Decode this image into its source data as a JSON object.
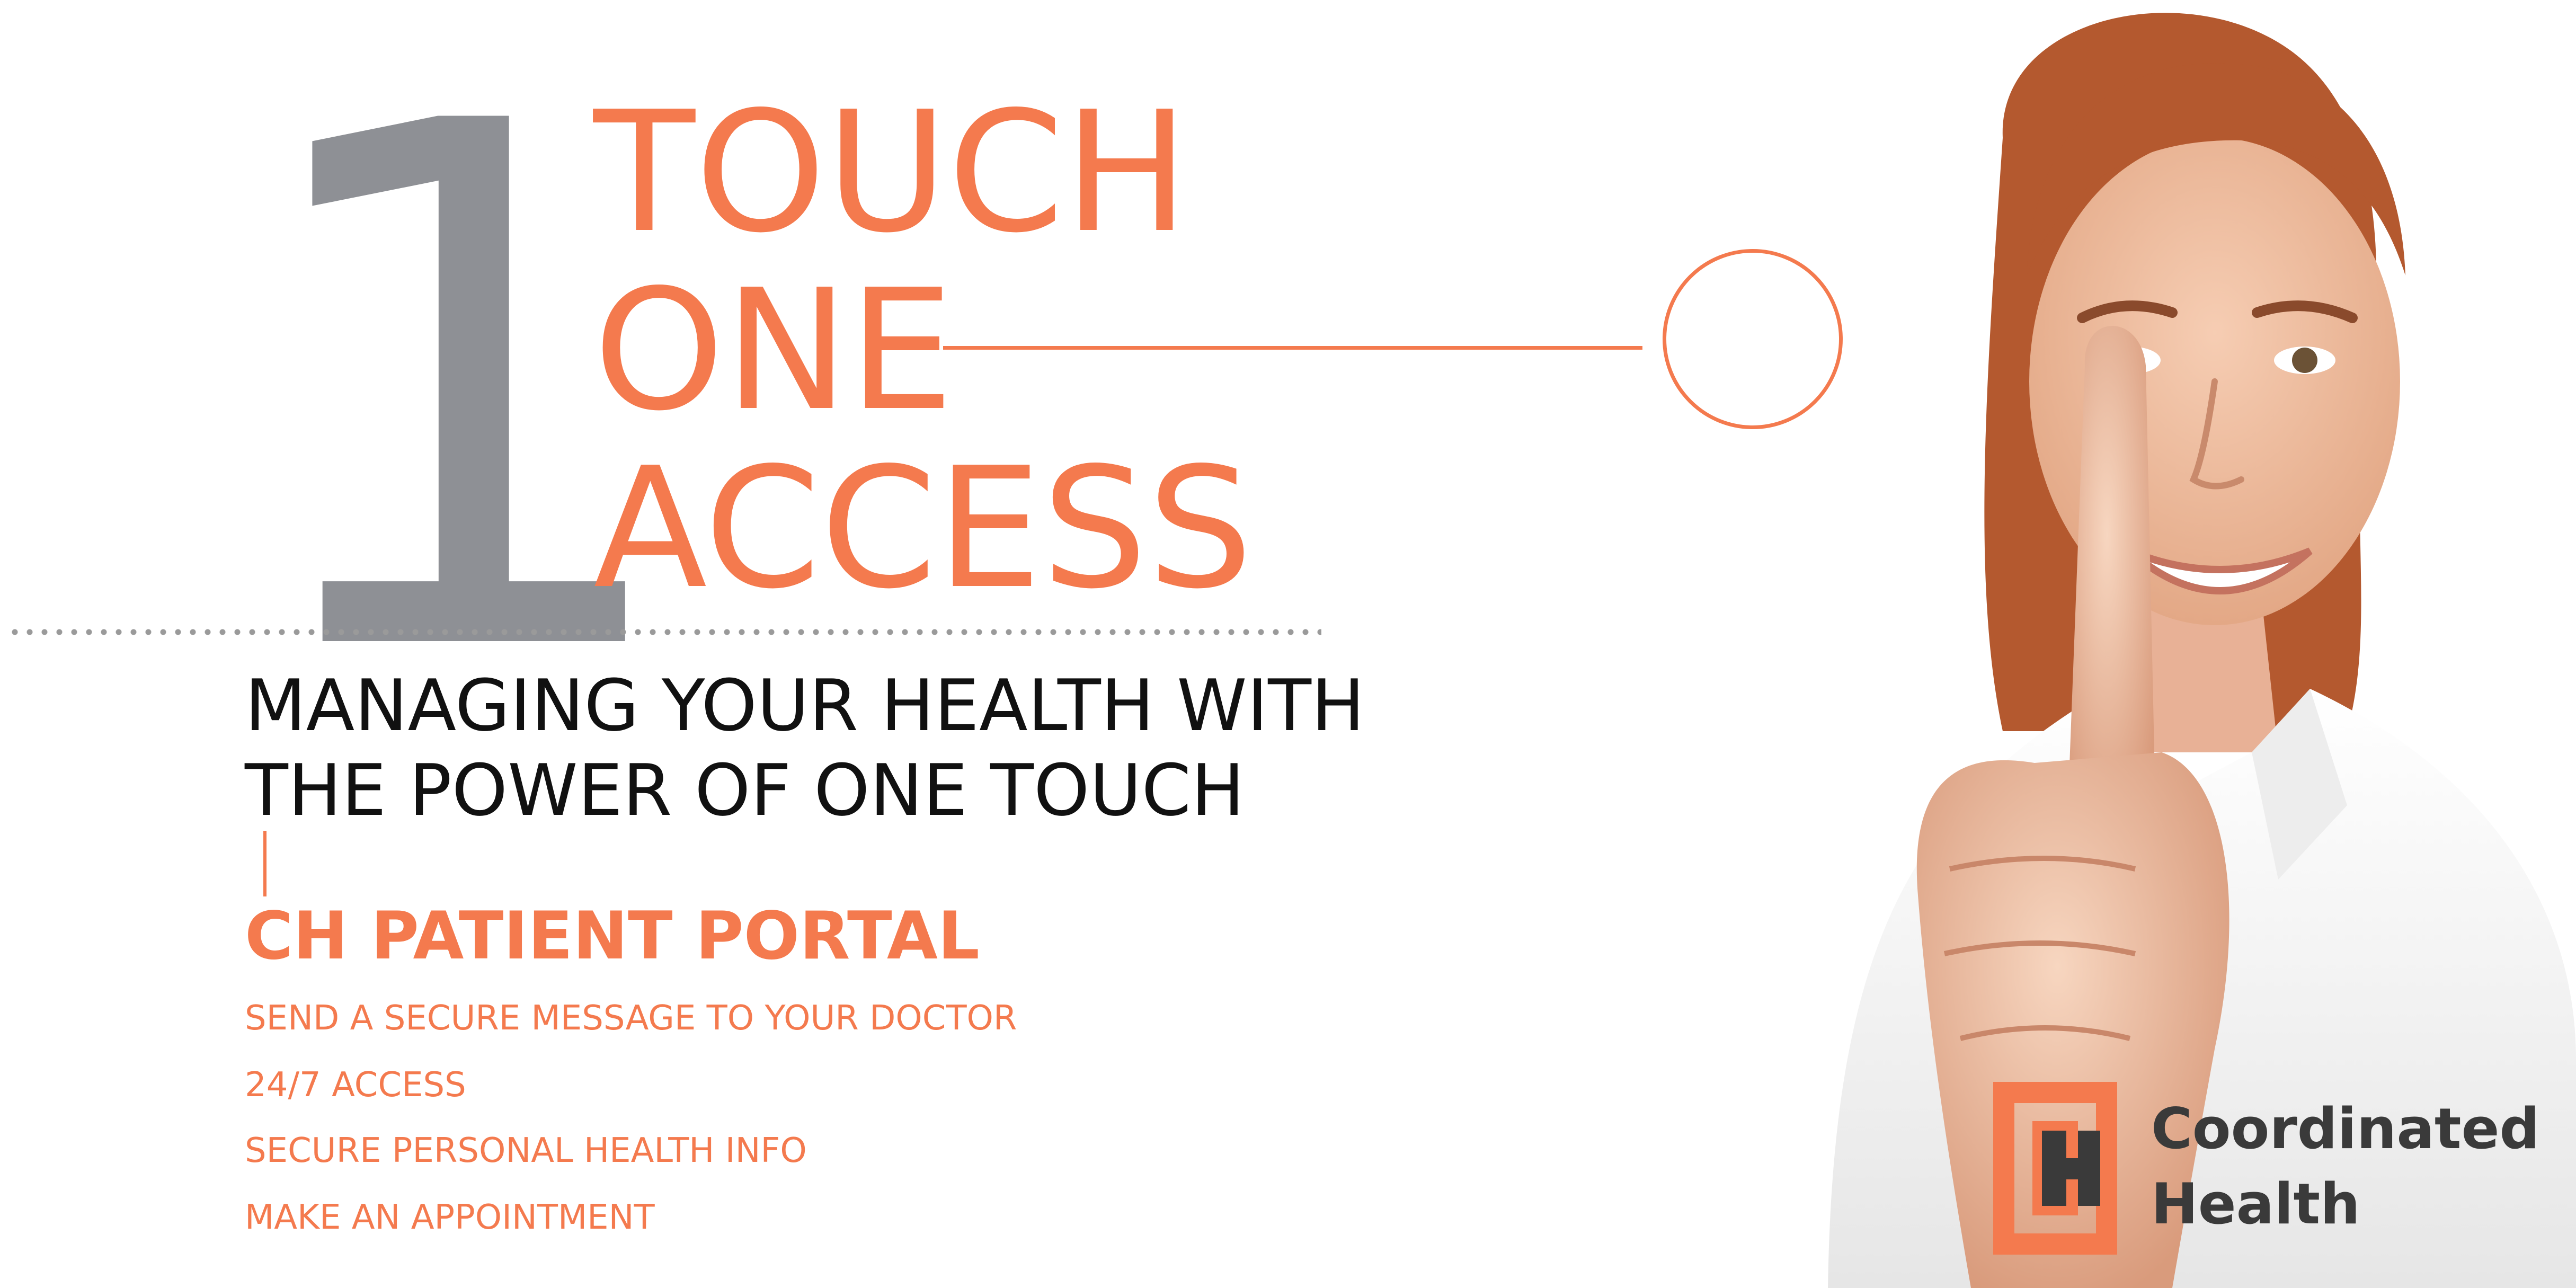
{
  "colors": {
    "accent": "#f47a4e",
    "numeral": "#8e9095",
    "text_dark": "#111111",
    "logo_dark": "#3a3a3a",
    "background": "#ffffff"
  },
  "headline": {
    "numeral": "1",
    "lines": [
      "TOUCH",
      "ONE",
      "ACCESS"
    ]
  },
  "tagline": {
    "lines": [
      "MANAGING YOUR HEALTH WITH",
      "THE POWER OF ONE TOUCH"
    ]
  },
  "portal": {
    "title": "CH PATIENT PORTAL",
    "features": [
      "SEND A SECURE MESSAGE TO YOUR DOCTOR",
      "24/7 ACCESS",
      "SECURE PERSONAL HEALTH INFO",
      "MAKE AN APPOINTMENT"
    ]
  },
  "logo": {
    "icon": "coordinated-health-logo-mark",
    "lines": [
      "Coordinated",
      "Health"
    ]
  },
  "photo": {
    "icon": "woman-pointing-finger-photo"
  }
}
